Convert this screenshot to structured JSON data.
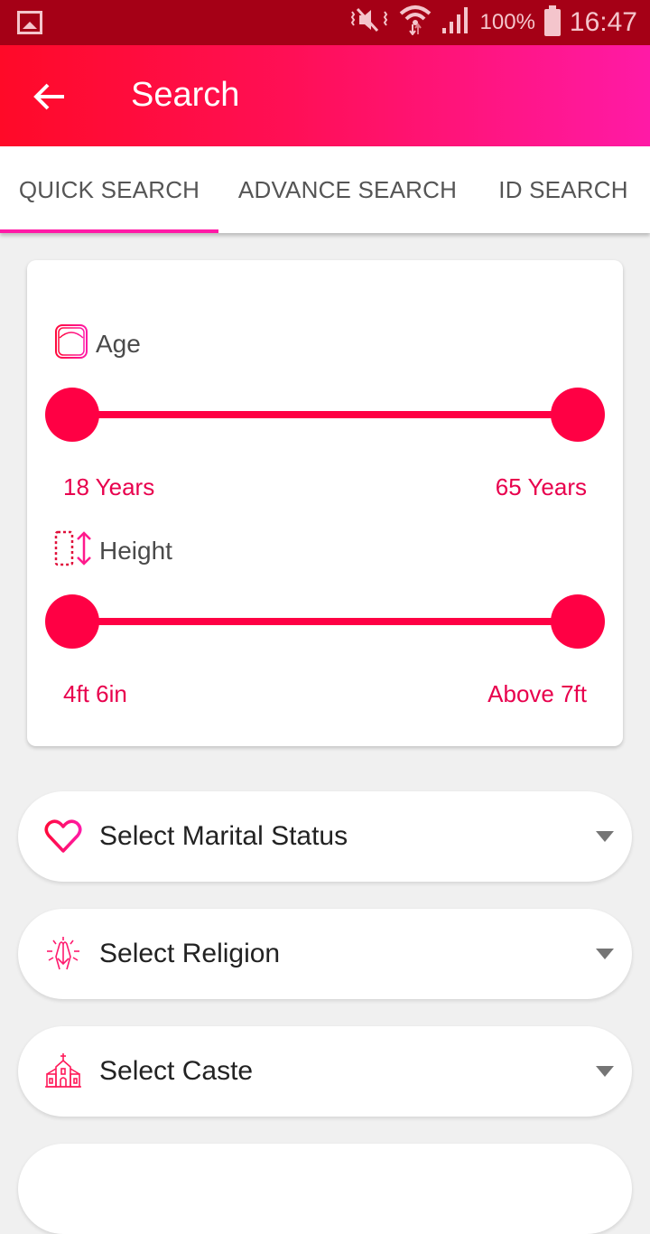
{
  "status_bar": {
    "left_icon": "image-icon",
    "icons": [
      "mute-vibrate-icon",
      "wifi-icon",
      "signal-icon"
    ],
    "battery": "100%",
    "time": "16:47"
  },
  "app_bar": {
    "back_icon": "arrow-left-icon",
    "title": "Search"
  },
  "tabs": [
    {
      "label": "QUICK SEARCH",
      "active": true
    },
    {
      "label": "ADVANCE SEARCH",
      "active": false
    },
    {
      "label": "ID SEARCH",
      "active": false
    }
  ],
  "filters": {
    "age": {
      "label": "Age",
      "icon": "scale-icon",
      "min_label": "18 Years",
      "max_label": "65 Years",
      "min_fraction": 0,
      "max_fraction": 1
    },
    "height": {
      "label": "Height",
      "icon": "height-icon",
      "min_label": "4ft 6in",
      "max_label": "Above 7ft",
      "min_fraction": 0,
      "max_fraction": 1
    }
  },
  "dropdowns": [
    {
      "label": "Select Marital Status",
      "icon": "heart-icon"
    },
    {
      "label": "Select Religion",
      "icon": "praying-hands-icon"
    },
    {
      "label": "Select Caste",
      "icon": "church-icon"
    }
  ],
  "colors": {
    "accent": "#ff0044",
    "tab_indicator": "#ff1aa6",
    "status_bar": "#a50016"
  }
}
